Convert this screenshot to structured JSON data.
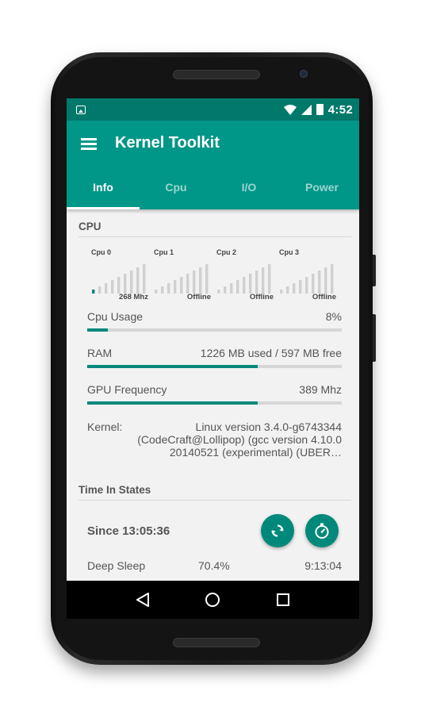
{
  "statusbar": {
    "time": "4:52"
  },
  "appbar": {
    "title": "Kernel Toolkit"
  },
  "tabs": [
    {
      "label": "Info",
      "active": true
    },
    {
      "label": "Cpu",
      "active": false
    },
    {
      "label": "I/O",
      "active": false
    },
    {
      "label": "Power",
      "active": false
    }
  ],
  "cpu_section": {
    "title": "CPU",
    "cores": [
      {
        "name": "Cpu 0",
        "freq": "268 Mhz",
        "active_bars": 1
      },
      {
        "name": "Cpu 1",
        "freq": "Offline",
        "active_bars": 0
      },
      {
        "name": "Cpu 2",
        "freq": "Offline",
        "active_bars": 0
      },
      {
        "name": "Cpu 3",
        "freq": "Offline",
        "active_bars": 0
      }
    ]
  },
  "stats": {
    "cpu_usage": {
      "label": "Cpu Usage",
      "value": "8%",
      "fraction": 0.08
    },
    "ram": {
      "label": "RAM",
      "value": "1226 MB used / 597 MB free",
      "fraction": 0.67
    },
    "gpu": {
      "label": "GPU Frequency",
      "value": "389 Mhz",
      "fraction": 0.67
    }
  },
  "kernel": {
    "label": "Kernel:",
    "line1": "Linux version 3.4.0-g6743344",
    "line2": "(CodeCraft@Lollipop) (gcc version 4.10.0",
    "line3": "20140521 (experimental) (UBER…"
  },
  "time_in_states": {
    "title": "Time In States",
    "since": "Since 13:05:36",
    "rows": [
      {
        "name": "Deep Sleep",
        "percent": "70.4%",
        "time": "9:13:04"
      }
    ]
  },
  "colors": {
    "primary": "#009688",
    "primary_dark": "#00796b",
    "accent": "#00897b",
    "bar_inactive": "#d0d0d0"
  }
}
